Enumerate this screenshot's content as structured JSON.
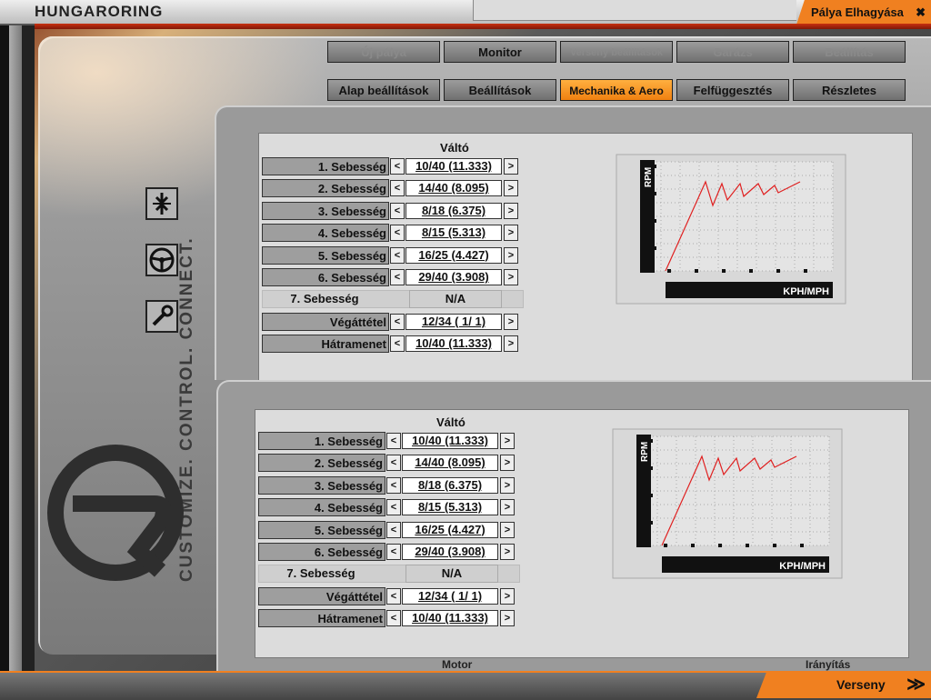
{
  "header": {
    "track_name": "HUNGARORING",
    "leave_button": "Pálya Elhagyása",
    "leave_icon": "✖"
  },
  "main_tabs": [
    {
      "label": "Új pálya",
      "state": "disabled"
    },
    {
      "label": "Monitor",
      "state": "normal"
    },
    {
      "label": "Verseny beállítások",
      "state": "disabled"
    },
    {
      "label": "Garázs",
      "state": "disabled"
    },
    {
      "label": "Beállítás",
      "state": "disabled"
    }
  ],
  "sub_tabs": [
    {
      "label": "Alap beállítások",
      "state": "normal"
    },
    {
      "label": "Beállítások",
      "state": "normal"
    },
    {
      "label": "Mechanika & Aero",
      "state": "active"
    },
    {
      "label": "Felfüggesztés",
      "state": "normal"
    },
    {
      "label": "Részletes",
      "state": "normal"
    }
  ],
  "side": {
    "slogan": "CUSTOMIZE. CONTROL. CONNECT.",
    "icons": [
      "pit-arrows-icon",
      "steering-wheel-icon",
      "wrench-icon"
    ]
  },
  "gearbox": {
    "title": "Váltó",
    "gears": [
      {
        "label": "1. Sebesség",
        "value": "10/40 (11.333)"
      },
      {
        "label": "2. Sebesség",
        "value": "14/40 (8.095)"
      },
      {
        "label": "3. Sebesség",
        "value": "8/18 (6.375)"
      },
      {
        "label": "4. Sebesség",
        "value": "8/15 (5.313)"
      },
      {
        "label": "5. Sebesség",
        "value": "16/25 (4.427)"
      },
      {
        "label": "6. Sebesség",
        "value": "29/40 (3.908)"
      }
    ],
    "na_gear": {
      "label": "7. Sebesség",
      "value": "N/A"
    },
    "final": {
      "label": "Végáttétel",
      "value": "12/34 (   1/ 1)"
    },
    "reverse": {
      "label": "Hátramenet",
      "value": "10/40 (11.333)"
    },
    "left_arrow": "<",
    "right_arrow": ">"
  },
  "chart": {
    "ylabel": "RPM",
    "xlabel": "KPH/MPH",
    "line_color": "#e02020"
  },
  "peek_labels": {
    "left": "Motor",
    "right": "Irányítás"
  },
  "footer": {
    "race_button": "Verseny",
    "race_icon": "≫"
  },
  "colors": {
    "accent": "#f08020",
    "panel": "#9a9a9a"
  }
}
